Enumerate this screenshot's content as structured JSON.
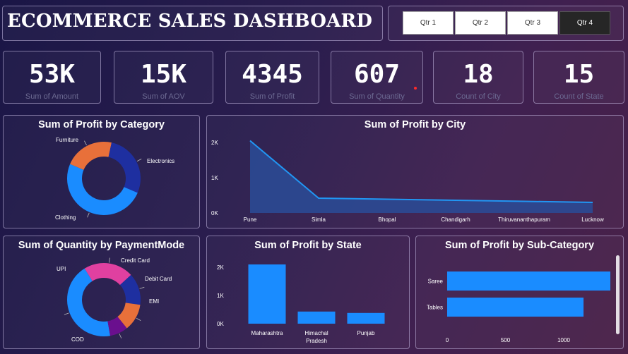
{
  "header": {
    "title": "ECOMMERCE SALES DASHBOARD"
  },
  "quarters": [
    {
      "label": "Qtr 1",
      "selected": false
    },
    {
      "label": "Qtr 2",
      "selected": false
    },
    {
      "label": "Qtr 3",
      "selected": false
    },
    {
      "label": "Qtr 4",
      "selected": true
    }
  ],
  "kpis": [
    {
      "value": "53K",
      "label": "Sum of Amount"
    },
    {
      "value": "15K",
      "label": "Sum of AOV"
    },
    {
      "value": "4345",
      "label": "Sum of Profit"
    },
    {
      "value": "607",
      "label": "Sum of Quantity"
    },
    {
      "value": "18",
      "label": "Count of City"
    },
    {
      "value": "15",
      "label": "Count of State"
    }
  ],
  "colors": {
    "blue": "#1a8cff",
    "navy": "#1e2fa0",
    "orange": "#e8703a",
    "pink": "#e040a0",
    "purple": "#6a0f8e",
    "area_fill": "#2b4a93",
    "area_line": "#2196f3"
  },
  "chart_data": [
    {
      "type": "pie",
      "title": "Sum of Profit by Category",
      "categories": [
        "Clothing",
        "Furniture",
        "Electronics"
      ],
      "values": [
        50,
        22,
        28
      ]
    },
    {
      "type": "area",
      "title": "Sum of Profit by City",
      "categories": [
        "Pune",
        "Simla",
        "Bhopal",
        "Chandigarh",
        "Thiruvananthapuram",
        "Lucknow"
      ],
      "values": [
        2050,
        420,
        390,
        360,
        330,
        300
      ],
      "yticks": [
        "0K",
        "1K",
        "2K"
      ],
      "ylim": [
        0,
        2200
      ]
    },
    {
      "type": "pie",
      "title": "Sum of Quantity by PaymentMode",
      "categories": [
        "COD",
        "UPI",
        "Credit Card",
        "Debit Card",
        "EMI"
      ],
      "values": [
        44,
        22,
        14,
        12,
        8
      ]
    },
    {
      "type": "bar",
      "title": "Sum of Profit by State",
      "categories": [
        "Maharashtra",
        "Himachal Pradesh",
        "Punjab"
      ],
      "values": [
        2100,
        430,
        380
      ],
      "yticks": [
        "0K",
        "1K",
        "2K"
      ],
      "ylim": [
        0,
        2300
      ]
    },
    {
      "type": "bar",
      "title": "Sum of Profit by Sub-Category",
      "orientation": "horizontal",
      "categories": [
        "Saree",
        "Tables"
      ],
      "values": [
        1400,
        1170
      ],
      "xticks": [
        "0",
        "500",
        "1000"
      ],
      "xlim": [
        0,
        1500
      ]
    }
  ]
}
